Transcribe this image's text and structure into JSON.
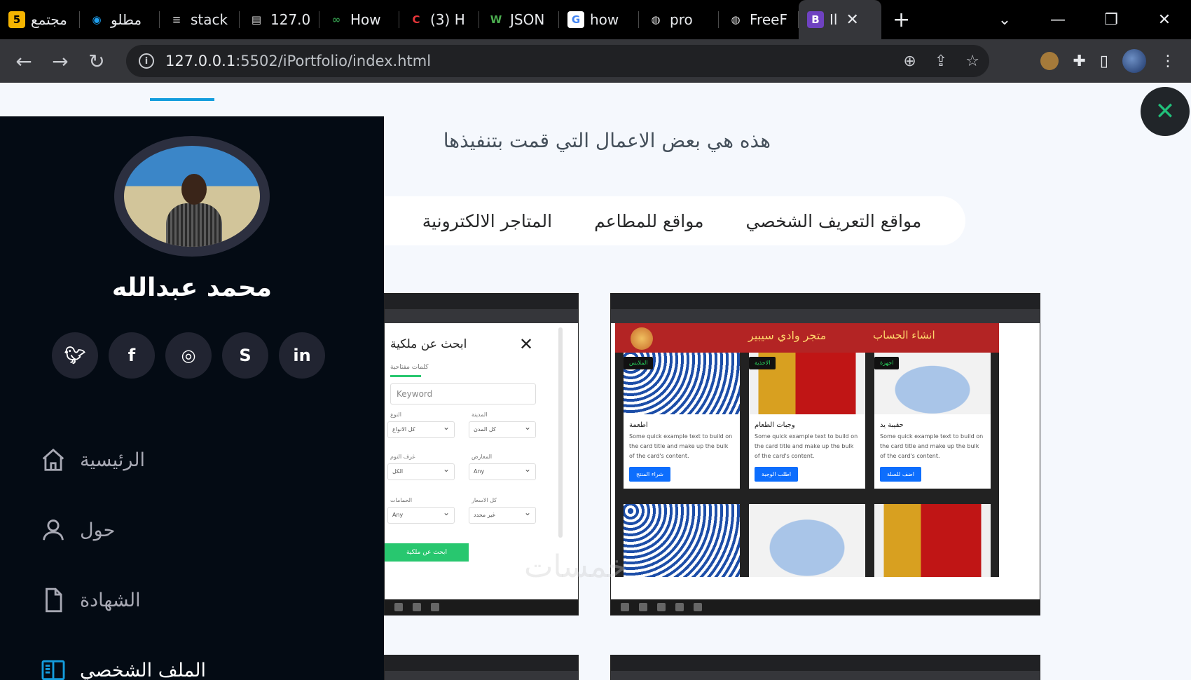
{
  "browser": {
    "tabs": [
      {
        "title": "مجتمع",
        "favicon": "5",
        "favicon_bg": "#f5b400",
        "favicon_color": "#000"
      },
      {
        "title": "مطلو",
        "favicon": "◉",
        "favicon_bg": "#000",
        "favicon_color": "#1ea0f0"
      },
      {
        "title": "stack",
        "favicon": "≡",
        "favicon_bg": "#000",
        "favicon_color": "#bbb"
      },
      {
        "title": "127.0",
        "favicon": "▤",
        "favicon_bg": "#000",
        "favicon_color": "#ddd"
      },
      {
        "title": "How",
        "favicon": "∞",
        "favicon_bg": "#000",
        "favicon_color": "#2f8d46"
      },
      {
        "title": "(3) H",
        "favicon": "C",
        "favicon_bg": "#000",
        "favicon_color": "#e8363a"
      },
      {
        "title": "JSON",
        "favicon": "W",
        "favicon_bg": "#000",
        "favicon_color": "#4caf50"
      },
      {
        "title": "how",
        "favicon": "G",
        "favicon_bg": "#fff",
        "favicon_color": "#4285f4"
      },
      {
        "title": "pro",
        "favicon": "◍",
        "favicon_bg": "#000",
        "favicon_color": "#ddd"
      },
      {
        "title": "FreeF",
        "favicon": "◍",
        "favicon_bg": "#000",
        "favicon_color": "#ddd"
      }
    ],
    "active_tab": {
      "title": "Il",
      "favicon": "B"
    },
    "url_host": "127.0.0.1",
    "url_path": ":5502/iPortfolio/index.html"
  },
  "profile": {
    "name": "محمد عبدالله",
    "socials": [
      {
        "icon": "twitter-icon",
        "glyph": "🐦︎"
      },
      {
        "icon": "facebook-icon",
        "glyph": "f"
      },
      {
        "icon": "instagram-icon",
        "glyph": "◎"
      },
      {
        "icon": "skype-icon",
        "glyph": "S"
      },
      {
        "icon": "linkedin-icon",
        "glyph": "in"
      }
    ]
  },
  "nav": [
    {
      "label": "الرئيسية",
      "icon": "home-icon"
    },
    {
      "label": "حول",
      "icon": "user-icon"
    },
    {
      "label": "الشهادة",
      "icon": "file-icon"
    },
    {
      "label": "الملف الشخصي",
      "icon": "book-icon"
    }
  ],
  "portfolio": {
    "title": "هذه هي بعض الاعمال التي قمت بتنفيذها",
    "filters": [
      "مواقع التعريف الشخصي",
      "مواقع للمطاعم",
      "المتاجر الالكترونية"
    ]
  },
  "thumb_search": {
    "title": "ابحث عن ملكية",
    "subtitle": "كلمات مفتاحية",
    "input_placeholder": "Keyword",
    "labels": [
      "المدينة",
      "النوع",
      "المعارض",
      "غرف النوم",
      "كل الاسعار",
      "الحمامات"
    ],
    "selects": [
      "كل المدن",
      "كل الانواع",
      "Any",
      "الكل",
      "غير محدد",
      "Any"
    ],
    "button": "ابحث عن ملكية"
  },
  "thumb_shop": {
    "account": "انشاء الحساب",
    "store_name": "متجر وادي سيبير",
    "cards": [
      {
        "badge": "اجهزة",
        "title": "حقيبة يد",
        "text": "Some quick example text to build on the card title and make up the bulk of the card's content.",
        "button": "اضف للسلة"
      },
      {
        "badge": "الاحذية",
        "title": "وجبات الطعام",
        "text": "Some quick example text to build on the card title and make up the bulk of the card's content.",
        "button": "اطلب الوجبة"
      },
      {
        "badge": "الملابس",
        "title": "اطعمة",
        "text": "Some quick example text to build on the card title and make up the bulk of the card's content.",
        "button": "شراء المنتج"
      }
    ]
  },
  "watermark": "خمسات"
}
